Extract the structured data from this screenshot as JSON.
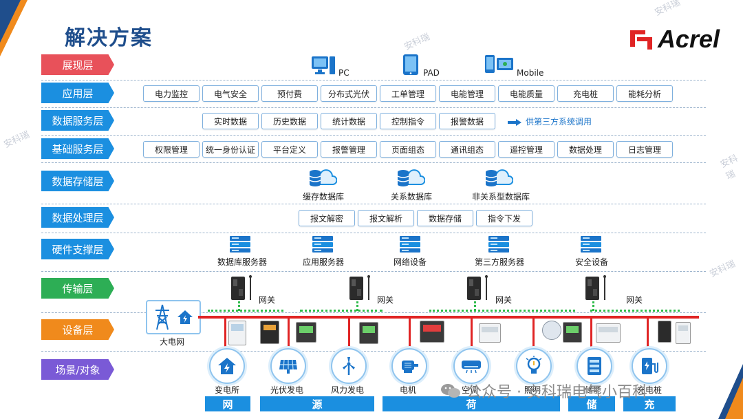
{
  "title": "解决方案",
  "logo": {
    "text": "Acrel"
  },
  "watermark": "安科瑞",
  "layers": [
    {
      "label": "展现层"
    },
    {
      "label": "应用层"
    },
    {
      "label": "数据服务层"
    },
    {
      "label": "基础服务层"
    },
    {
      "label": "数据存储层"
    },
    {
      "label": "数据处理层"
    },
    {
      "label": "硬件支撑层"
    },
    {
      "label": "传输层"
    },
    {
      "label": "设备层"
    },
    {
      "label": "场景/对象"
    }
  ],
  "presentation": [
    "PC",
    "PAD",
    "Mobile"
  ],
  "application": [
    "电力监控",
    "电气安全",
    "预付费",
    "分布式光伏",
    "工单管理",
    "电能管理",
    "电能质量",
    "充电桩",
    "能耗分析"
  ],
  "data_service": [
    "实时数据",
    "历史数据",
    "统计数据",
    "控制指令",
    "报警数据"
  ],
  "data_service_note": "供第三方系统调用",
  "basic_service": [
    "权限管理",
    "统一身份认证",
    "平台定义",
    "报警管理",
    "页面组态",
    "通讯组态",
    "遥控管理",
    "数据处理",
    "日志管理"
  ],
  "storage": [
    "缓存数据库",
    "关系数据库",
    "非关系型数据库"
  ],
  "processing": [
    "报文解密",
    "报文解析",
    "数据存储",
    "指令下发"
  ],
  "hardware": [
    "数据库服务器",
    "应用服务器",
    "网络设备",
    "第三方服务器",
    "安全设备"
  ],
  "gateway_label": "网关",
  "grid_label": "大电网",
  "scenes": [
    "变电所",
    "光伏发电",
    "风力发电",
    "电机",
    "空调",
    "照明",
    "储能",
    "充电桩"
  ],
  "categories": [
    "网",
    "源",
    "荷",
    "储",
    "充"
  ],
  "footer": "公众号 · 安科瑞电气小百科",
  "colors": {
    "primary": "#1f4e8c",
    "accent": "#f08a1c",
    "bus": "#e02424",
    "link": "#2dbb4a"
  }
}
